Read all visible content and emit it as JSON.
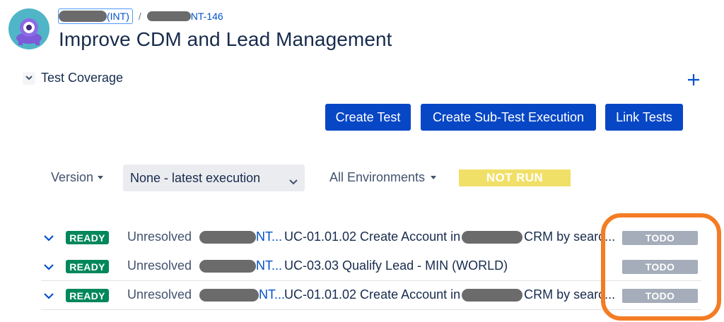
{
  "header": {
    "breadcrumb": {
      "project_suffix": "(INT)",
      "separator": "/",
      "issue_key_suffix": "NT-146"
    },
    "title": "Improve CDM and Lead Management"
  },
  "section": {
    "title": "Test Coverage",
    "add_icon": "plus-icon"
  },
  "actions": {
    "create_test": "Create Test",
    "create_sub_test_execution": "Create Sub-Test Execution",
    "link_tests": "Link Tests"
  },
  "filters": {
    "version_label": "Version",
    "execution_selected": "None - latest execution",
    "environments_label": "All Environments",
    "overall_status": "NOT RUN"
  },
  "tests": [
    {
      "status": "READY",
      "resolution": "Unresolved",
      "key_suffix": "NT...",
      "summary_before": "UC-01.01.02 Create Account in",
      "summary_after": "CRM by searc...",
      "execution_status": "TODO"
    },
    {
      "status": "READY",
      "resolution": "Unresolved",
      "key_suffix": "NT...",
      "summary_before": "UC-03.03 Qualify Lead - MIN (WORLD)",
      "summary_after": "",
      "execution_status": "TODO"
    },
    {
      "status": "READY",
      "resolution": "Unresolved",
      "key_suffix": "NT...",
      "summary_before": "UC-01.01.02 Create Account in",
      "summary_after": "CRM by searc...",
      "execution_status": "TODO"
    }
  ],
  "colors": {
    "primary_button": "#0747c6",
    "ready_badge": "#00875a",
    "todo_badge": "#a5adba",
    "not_run_badge": "#f1e068",
    "annotation_outline": "#f47c24",
    "link": "#0052cc"
  }
}
